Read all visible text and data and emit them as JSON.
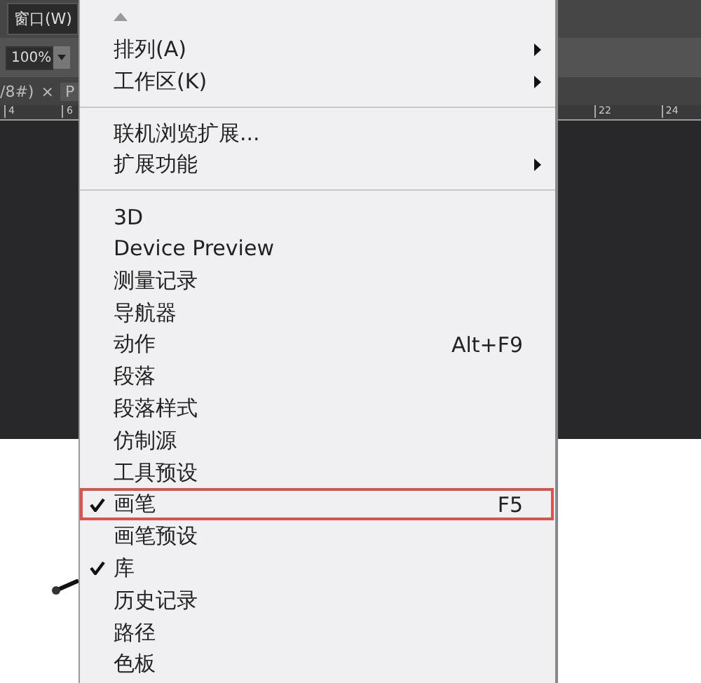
{
  "menu_bar": {
    "item": "窗口(W)"
  },
  "toolbar": {
    "zoom": "100%"
  },
  "document_tab": {
    "label": "/8#)",
    "close": "×",
    "next_tab": "P"
  },
  "ruler": {
    "left_ticks": [
      "4",
      "6"
    ],
    "right_ticks": [
      "22",
      "24"
    ]
  },
  "menu": {
    "items": [
      {
        "kind": "scroll_up"
      },
      {
        "kind": "item",
        "label": "排列(A)",
        "submenu": true
      },
      {
        "kind": "item",
        "label": "工作区(K)",
        "submenu": true
      },
      {
        "kind": "separator"
      },
      {
        "kind": "item",
        "label": "联机浏览扩展..."
      },
      {
        "kind": "item",
        "label": "扩展功能",
        "submenu": true
      },
      {
        "kind": "separator"
      },
      {
        "kind": "item",
        "label": "3D"
      },
      {
        "kind": "item",
        "label": "Device Preview"
      },
      {
        "kind": "item",
        "label": "测量记录"
      },
      {
        "kind": "item",
        "label": "导航器"
      },
      {
        "kind": "item",
        "label": "动作",
        "shortcut": "Alt+F9"
      },
      {
        "kind": "item",
        "label": "段落"
      },
      {
        "kind": "item",
        "label": "段落样式"
      },
      {
        "kind": "item",
        "label": "仿制源"
      },
      {
        "kind": "item",
        "label": "工具预设"
      },
      {
        "kind": "item",
        "label": "画笔",
        "shortcut": "F5",
        "checked": true,
        "highlighted": true
      },
      {
        "kind": "item",
        "label": "画笔预设"
      },
      {
        "kind": "item",
        "label": "库",
        "checked": true
      },
      {
        "kind": "item",
        "label": "历史记录"
      },
      {
        "kind": "item",
        "label": "路径"
      },
      {
        "kind": "item",
        "label": "色板"
      }
    ]
  }
}
